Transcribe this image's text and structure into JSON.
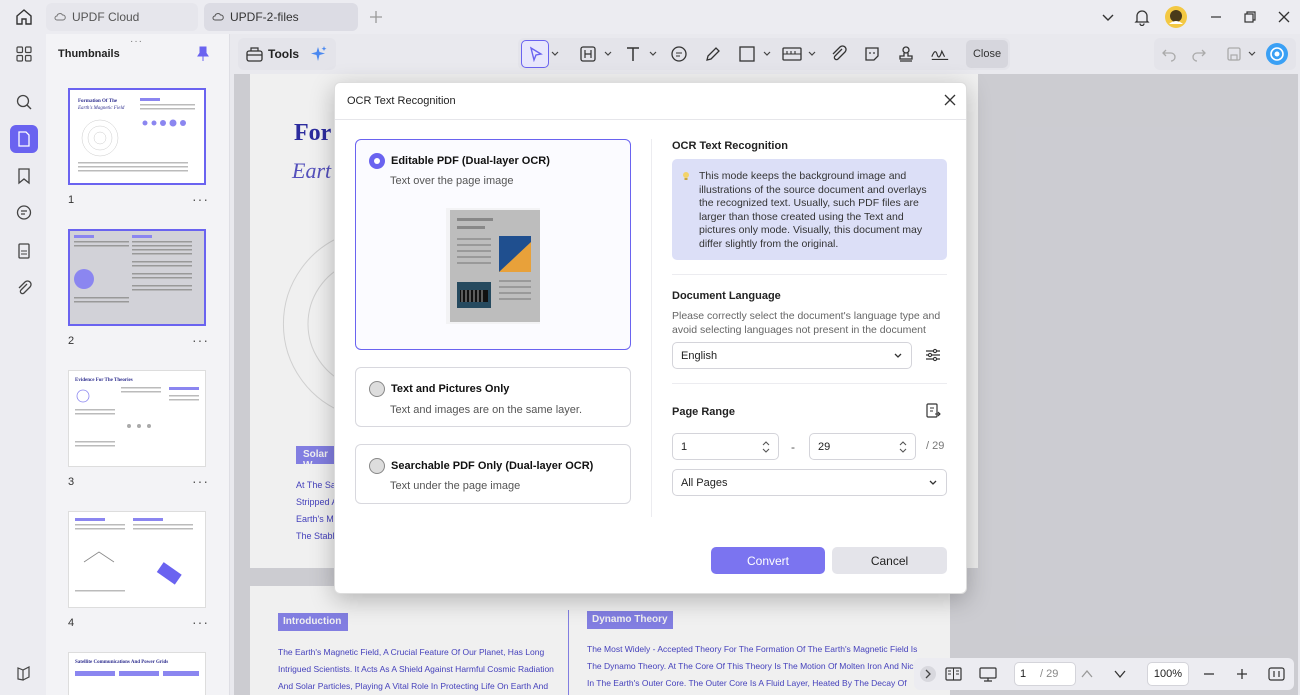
{
  "tabs": [
    {
      "label": "UPDF Cloud"
    },
    {
      "label": "UPDF-2-files"
    }
  ],
  "thumbnails": {
    "title": "Thumbnails",
    "pages": [
      "1",
      "2",
      "3",
      "4"
    ],
    "more": "···"
  },
  "toolbar": {
    "tools_label": "Tools",
    "close_label": "Close"
  },
  "document": {
    "heading_line1": "For",
    "heading_line2": "Eart",
    "solar_badge": "Solar W",
    "links": [
      "At The Sar",
      "Stripped A",
      "Earth's Ma",
      "The Stable"
    ],
    "page2": {
      "intro_badge": "Introduction",
      "intro_lines": [
        "The Earth's Magnetic Field, A Crucial Feature Of Our Planet, Has Long",
        "Intrigued Scientists. It Acts As A Shield Against Harmful Cosmic Radiation",
        "And Solar Particles, Playing A Vital Role In Protecting Life On Earth And"
      ],
      "dynamo_badge": "Dynamo Theory",
      "dynamo_lines": [
        "The Most Widely - Accepted Theory For The Formation Of The Earth's Magnetic Field Is",
        "The Dynamo Theory. At The Core Of This Theory Is The Motion Of Molten Iron And Nickel",
        "In The Earth's Outer Core. The Outer Core Is A Fluid Layer, Heated By The Decay Of"
      ]
    }
  },
  "dialog": {
    "title": "OCR Text Recognition",
    "options": [
      {
        "title": "Editable PDF (Dual-layer OCR)",
        "subtitle": "Text over the page image"
      },
      {
        "title": "Text and Pictures Only",
        "subtitle": "Text and images are on the same layer."
      },
      {
        "title": "Searchable PDF Only (Dual-layer OCR)",
        "subtitle": "Text under the page image"
      }
    ],
    "right_title": "OCR Text Recognition",
    "info": "This mode keeps the background image and illustrations of the source document and overlays the recognized text. Usually, such PDF files are larger than those created using the Text and pictures only mode. Visually, this document may differ slightly from the original.",
    "lang_title": "Document Language",
    "lang_desc": "Please correctly select the document's language type and avoid selecting languages not present in the document",
    "lang_value": "English",
    "range_title": "Page Range",
    "range_from": "1",
    "range_dash": "-",
    "range_to": "29",
    "range_total": "/ 29",
    "range_mode": "All Pages",
    "convert": "Convert",
    "cancel": "Cancel"
  },
  "bottombar": {
    "page_current": "1",
    "page_total": "/ 29",
    "zoom": "100%"
  },
  "colors": {
    "accent": "#6a63f0",
    "info_bg": "#dcdff7"
  }
}
